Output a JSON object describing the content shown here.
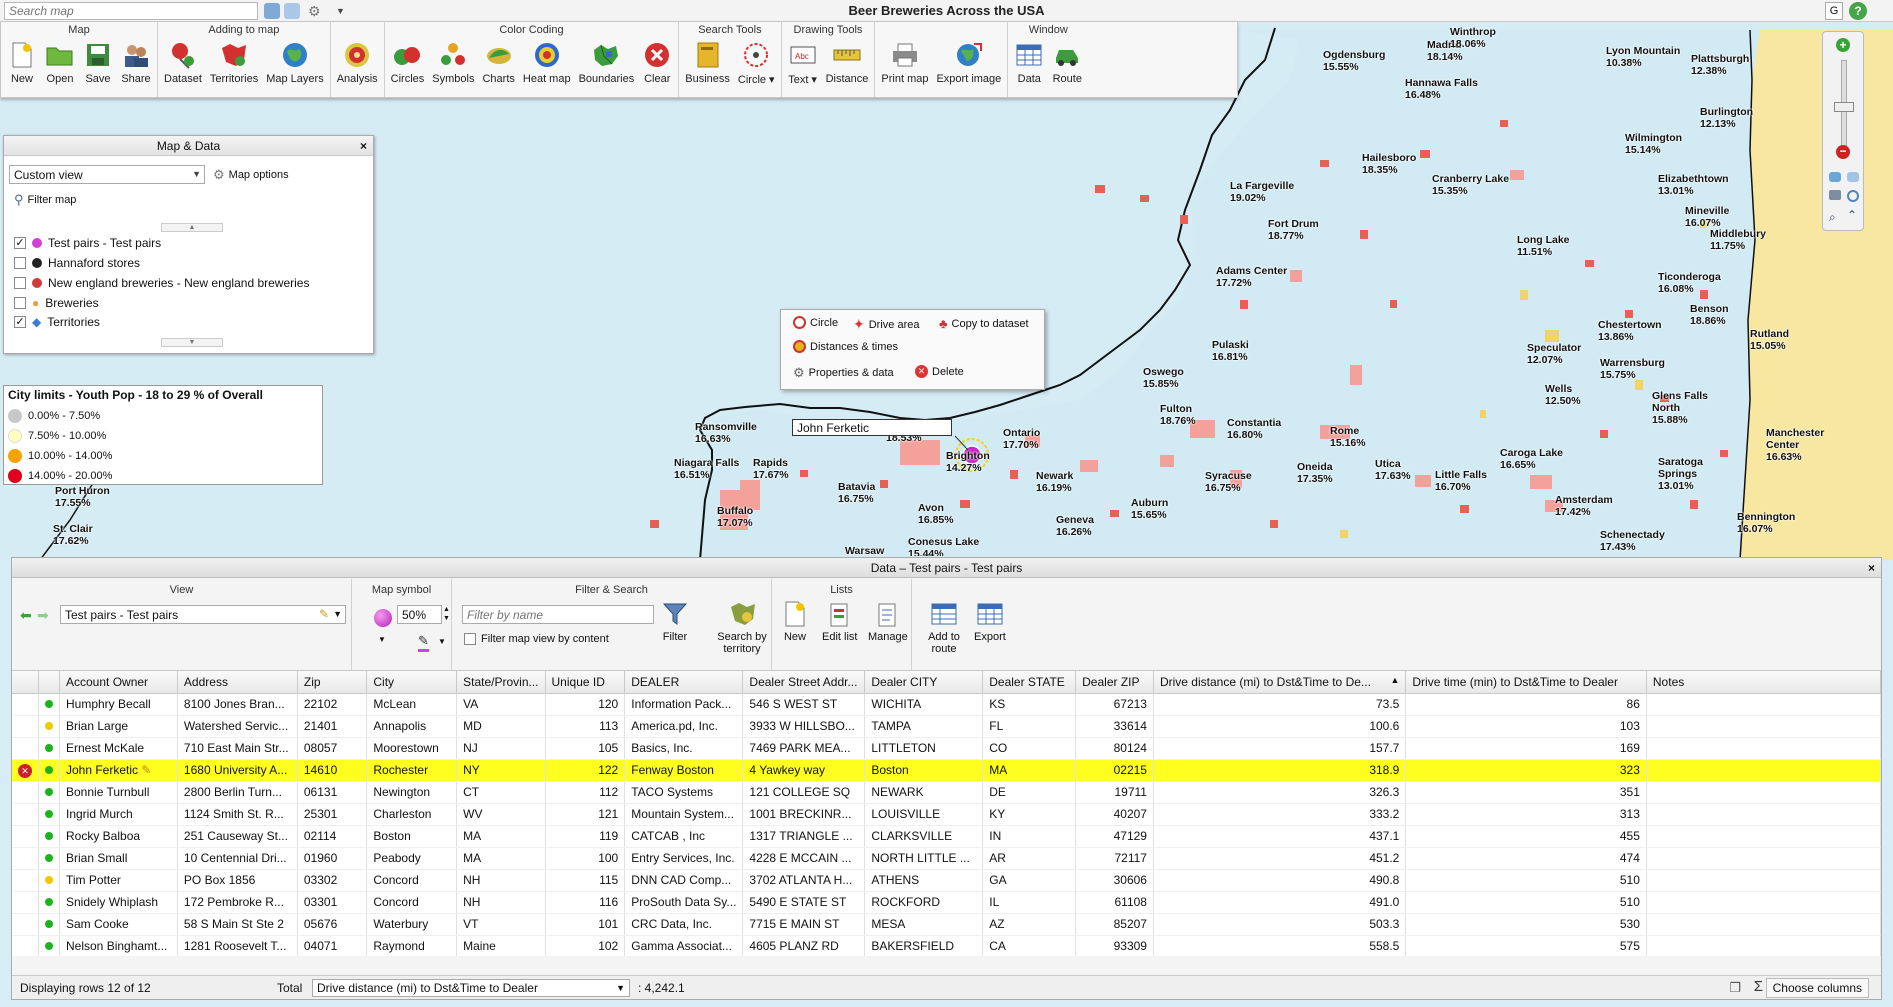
{
  "app": {
    "title": "Beer Breweries Across the USA",
    "search_placeholder": "Search map",
    "g_label": "G",
    "help_label": "?"
  },
  "ribbon": {
    "groups": [
      {
        "title": "Map",
        "buttons": [
          "New",
          "Open",
          "Save",
          "Share"
        ]
      },
      {
        "title": "Adding to map",
        "buttons": [
          "Dataset",
          "Territories",
          "Map Layers"
        ]
      },
      {
        "title": "",
        "buttons": [
          "Analysis"
        ]
      },
      {
        "title": "Color Coding",
        "buttons": [
          "Circles",
          "Symbols",
          "Charts",
          "Heat map",
          "Boundaries",
          "Clear"
        ]
      },
      {
        "title": "Search Tools",
        "buttons": [
          "Business",
          "Circle ▾"
        ]
      },
      {
        "title": "Drawing Tools",
        "buttons": [
          "Text ▾",
          "Distance"
        ]
      },
      {
        "title": "",
        "buttons": [
          "Print map",
          "Export image"
        ]
      },
      {
        "title": "Window",
        "buttons": [
          "Data",
          "Route"
        ]
      }
    ]
  },
  "map_data_panel": {
    "title": "Map & Data",
    "close": "×",
    "view": "Custom view",
    "map_options": "Map options",
    "filter_map": "Filter map",
    "layers": [
      {
        "label": "Test pairs - Test pairs",
        "checked": true,
        "color": "#d43fd8"
      },
      {
        "label": "Hannaford stores",
        "checked": false,
        "color": "#222222"
      },
      {
        "label": "New england breweries - New england breweries",
        "checked": false,
        "color": "#d33a3a"
      },
      {
        "label": "Breweries",
        "checked": false,
        "color": "#e3a23a"
      },
      {
        "label": "Territories",
        "checked": true,
        "color": "#3a7bd5"
      }
    ]
  },
  "legend": {
    "title": "City limits - Youth Pop - 18 to 29 % of Overall",
    "items": [
      {
        "label": "0.00% - 7.50%",
        "color": "#c8c8c8"
      },
      {
        "label": "7.50% - 10.00%",
        "color": "#ffffc0"
      },
      {
        "label": "10.00% - 14.00%",
        "color": "#f5a300"
      },
      {
        "label": "14.00% - 20.00%",
        "color": "#e0001b"
      }
    ]
  },
  "context_menu": {
    "items": [
      "Circle",
      "Drive area",
      "Copy to dataset",
      "Distances & times",
      "Properties & data",
      "Delete"
    ]
  },
  "map_label": "John Ferketic",
  "cities": [
    {
      "name": "Madrid",
      "pct": "18.14%"
    },
    {
      "name": "Winthrop",
      "pct": "18.06%"
    },
    {
      "name": "Ogdensburg",
      "pct": "15.55%"
    },
    {
      "name": "Hannawa Falls",
      "pct": "16.48%"
    },
    {
      "name": "Lyon Mountain",
      "pct": "10.38%"
    },
    {
      "name": "Plattsburgh",
      "pct": "12.38%"
    },
    {
      "name": "Burlington",
      "pct": "12.13%"
    },
    {
      "name": "Wilmington",
      "pct": "15.14%"
    },
    {
      "name": "Hailesboro",
      "pct": "18.35%"
    },
    {
      "name": "Cranberry Lake",
      "pct": "15.35%"
    },
    {
      "name": "Elizabethtown",
      "pct": "13.01%"
    },
    {
      "name": "La Fargeville",
      "pct": "19.02%"
    },
    {
      "name": "Mineville",
      "pct": "16.07%"
    },
    {
      "name": "Fort Drum",
      "pct": "18.77%"
    },
    {
      "name": "Middlebury",
      "pct": "11.75%"
    },
    {
      "name": "Long Lake",
      "pct": "11.51%"
    },
    {
      "name": "Adams Center",
      "pct": "17.72%"
    },
    {
      "name": "Ticonderoga",
      "pct": "16.08%"
    },
    {
      "name": "Benson",
      "pct": "18.86%"
    },
    {
      "name": "Chestertown",
      "pct": "13.86%"
    },
    {
      "name": "Rutland",
      "pct": "15.05%"
    },
    {
      "name": "Pulaski",
      "pct": "16.81%"
    },
    {
      "name": "Speculator",
      "pct": "12.07%"
    },
    {
      "name": "Warrensburg",
      "pct": "15.75%"
    },
    {
      "name": "Oswego",
      "pct": "15.85%"
    },
    {
      "name": "Wells",
      "pct": "12.50%"
    },
    {
      "name": "Glens Falls North",
      "pct": "15.88%"
    },
    {
      "name": "Fulton",
      "pct": "18.76%"
    },
    {
      "name": "Constantia",
      "pct": "16.80%"
    },
    {
      "name": "Manchester Center",
      "pct": "16.63%"
    },
    {
      "name": "Ransomville",
      "pct": "16.63%"
    },
    {
      "name": "Ontario",
      "pct": "17.70%"
    },
    {
      "name": "Rome",
      "pct": "15.16%"
    },
    {
      "name": "Caroga Lake",
      "pct": "16.65%"
    },
    {
      "name": "Niagara Falls",
      "pct": "16.51%"
    },
    {
      "name": "Rapids",
      "pct": "17.67%"
    },
    {
      "name": "Newark",
      "pct": "16.19%"
    },
    {
      "name": "Syracuse",
      "pct": "16.75%"
    },
    {
      "name": "Oneida",
      "pct": "17.35%"
    },
    {
      "name": "Utica",
      "pct": "17.63%"
    },
    {
      "name": "Little Falls",
      "pct": "16.70%"
    },
    {
      "name": "Saratoga Springs",
      "pct": "13.01%"
    },
    {
      "name": "Batavia",
      "pct": "16.75%"
    },
    {
      "name": "Amsterdam",
      "pct": "17.42%"
    },
    {
      "name": "Bennington",
      "pct": "16.07%"
    },
    {
      "name": "Buffalo",
      "pct": "17.07%"
    },
    {
      "name": "Avon",
      "pct": "16.85%"
    },
    {
      "name": "Geneva",
      "pct": "16.26%"
    },
    {
      "name": "Auburn",
      "pct": "15.65%"
    },
    {
      "name": "Schenectady",
      "pct": "17.43%"
    },
    {
      "name": "Port Huron",
      "pct": "17.55%"
    },
    {
      "name": "St. Clair",
      "pct": "17.62%"
    },
    {
      "name": "Conesus Lake",
      "pct": "15.44%"
    },
    {
      "name": "Warsaw",
      "pct": ""
    },
    {
      "name": "Brighton",
      "pct": "14.27%"
    },
    {
      "name": "",
      "pct": "18.53%"
    }
  ],
  "data_panel": {
    "title": "Data – Test pairs - Test pairs",
    "close": "×",
    "view_group": "View",
    "view_name": "Test pairs - Test pairs",
    "map_symbol_group": "Map symbol",
    "symbol_pct": "50%",
    "filter_group": "Filter & Search",
    "filter_placeholder": "Filter by name",
    "filter_view_label": "Filter map view by content",
    "filter_btn": "Filter",
    "search_territory_btn": "Search by territory",
    "lists_group": "Lists",
    "new_btn": "New",
    "edit_list_btn": "Edit list",
    "manage_btn": "Manage",
    "add_route_btn": "Add to route",
    "export_btn": "Export"
  },
  "table": {
    "columns": [
      "Account Owner",
      "Address",
      "Zip",
      "City",
      "State/Provin...",
      "Unique ID",
      "DEALER",
      "Dealer Street Addr...",
      "Dealer CITY",
      "Dealer STATE",
      "Dealer ZIP",
      "Drive distance (mi) to Dst&Time to De...",
      "Drive time (min) to Dst&Time to Dealer",
      "Notes"
    ],
    "rows": [
      {
        "status": "#1db31d",
        "cells": [
          "Humphry Becall",
          "8100 Jones Bran...",
          "22102",
          "McLean",
          "VA",
          "120",
          "Information Pack...",
          "546 S WEST ST",
          "WICHITA",
          "KS",
          "67213",
          "73.5",
          "86",
          ""
        ]
      },
      {
        "status": "#f0c800",
        "cells": [
          "Brian Large",
          "Watershed Servic...",
          "21401",
          "Annapolis",
          "MD",
          "113",
          "America.pd, Inc.",
          "3933 W HILLSBO...",
          "TAMPA",
          "FL",
          "33614",
          "100.6",
          "103",
          ""
        ]
      },
      {
        "status": "#1db31d",
        "cells": [
          "Ernest McKale",
          "710 East Main Str...",
          "08057",
          "Moorestown",
          "NJ",
          "105",
          "Basics, Inc.",
          "7469 PARK MEA...",
          "LITTLETON",
          "CO",
          "80124",
          "157.7",
          "169",
          ""
        ]
      },
      {
        "status": "#1db31d",
        "selected": true,
        "cells": [
          "John Ferketic",
          "1680 University A...",
          "14610",
          "Rochester",
          "NY",
          "122",
          "Fenway Boston",
          "4 Yawkey way",
          "Boston",
          "MA",
          "02215",
          "318.9",
          "323",
          ""
        ]
      },
      {
        "status": "#1db31d",
        "cells": [
          "Bonnie Turnbull",
          "2800 Berlin Turn...",
          "06131",
          "Newington",
          "CT",
          "112",
          "TACO Systems",
          "121 COLLEGE SQ",
          "NEWARK",
          "DE",
          "19711",
          "326.3",
          "351",
          ""
        ]
      },
      {
        "status": "#1db31d",
        "cells": [
          "Ingrid Murch",
          "1124 Smith St. R...",
          "25301",
          "Charleston",
          "WV",
          "121",
          "Mountain System...",
          "1001 BRECKINR...",
          "LOUISVILLE",
          "KY",
          "40207",
          "333.2",
          "313",
          ""
        ]
      },
      {
        "status": "#1db31d",
        "cells": [
          "Rocky Balboa",
          "251 Causeway St...",
          "02114",
          "Boston",
          "MA",
          "119",
          "CATCAB , Inc",
          "1317 TRIANGLE ...",
          "CLARKSVILLE",
          "IN",
          "47129",
          "437.1",
          "455",
          ""
        ]
      },
      {
        "status": "#1db31d",
        "cells": [
          "Brian Small",
          "10 Centennial Dri...",
          "01960",
          "Peabody",
          "MA",
          "100",
          "Entry Services, Inc.",
          "4228 E MCCAIN ...",
          "NORTH LITTLE ...",
          "AR",
          "72117",
          "451.2",
          "474",
          ""
        ]
      },
      {
        "status": "#f0c800",
        "cells": [
          "Tim Potter",
          "PO Box 1856",
          "03302",
          "Concord",
          "NH",
          "115",
          "DNN CAD Comp...",
          "3702 ATLANTA H...",
          "ATHENS",
          "GA",
          "30606",
          "490.8",
          "510",
          ""
        ]
      },
      {
        "status": "#1db31d",
        "cells": [
          "Snidely Whiplash",
          "172 Pembroke R...",
          "03301",
          "Concord",
          "NH",
          "116",
          "ProSouth Data Sy...",
          "5490 E STATE ST",
          "ROCKFORD",
          "IL",
          "61108",
          "491.0",
          "510",
          ""
        ]
      },
      {
        "status": "#1db31d",
        "cells": [
          "Sam Cooke",
          "58 S Main St Ste 2",
          "05676",
          "Waterbury",
          "VT",
          "101",
          "CRC Data, Inc.",
          "7715 E MAIN ST",
          "MESA",
          "AZ",
          "85207",
          "503.3",
          "530",
          ""
        ]
      },
      {
        "status": "#1db31d",
        "cells": [
          "Nelson Binghamt...",
          "1281 Roosevelt T...",
          "04071",
          "Raymond",
          "Maine",
          "102",
          "Gamma Associat...",
          "4605 PLANZ RD",
          "BAKERSFIELD",
          "CA",
          "93309",
          "558.5",
          "575",
          ""
        ]
      }
    ]
  },
  "status": {
    "rows_text": "Displaying rows 12 of 12",
    "total_label": "Total",
    "total_field": "Drive distance (mi) to Dst&Time to Dealer",
    "total_value": ": 4,242.1",
    "choose_columns": "Choose columns"
  }
}
